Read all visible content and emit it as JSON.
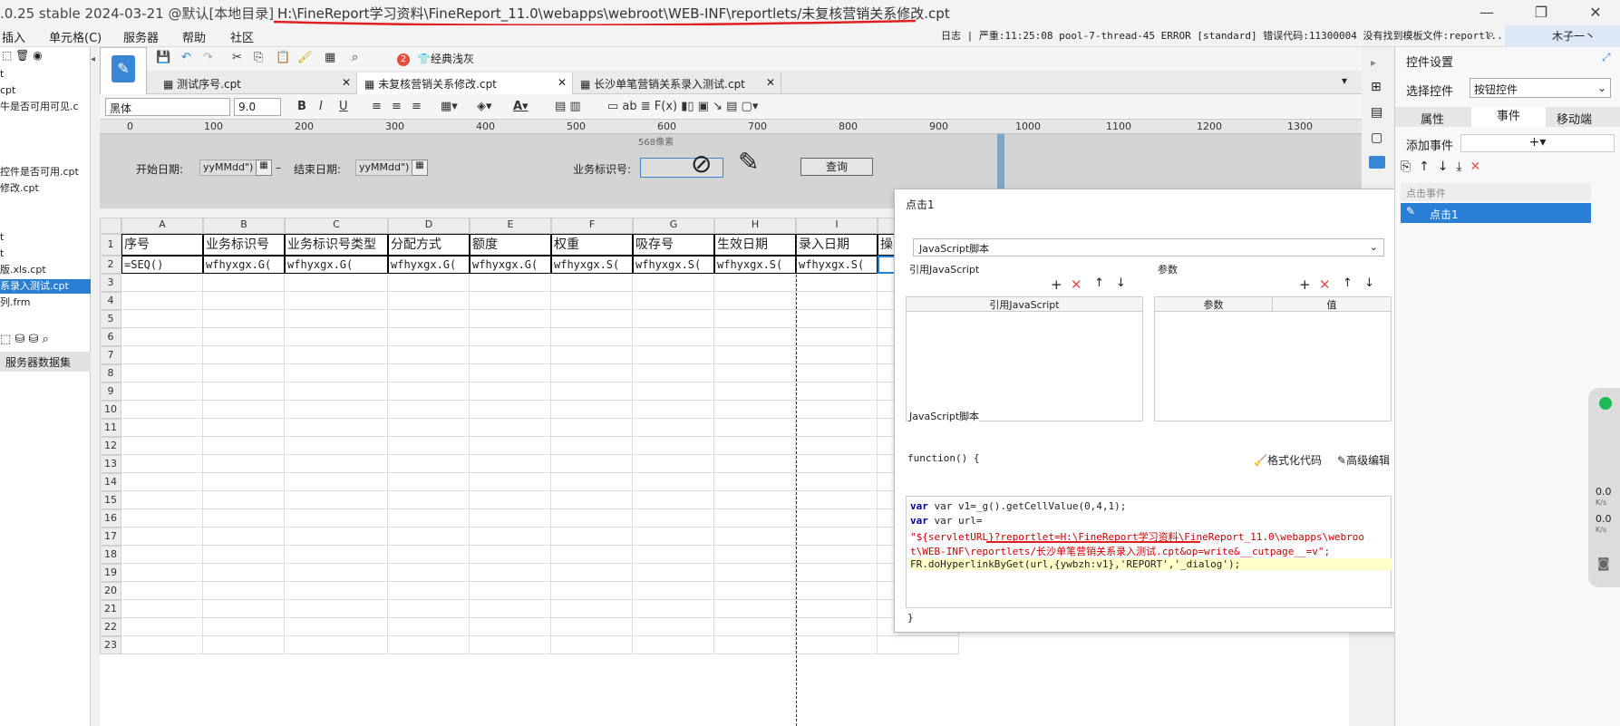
{
  "window": {
    "title": ".0.25 stable 2024-03-21 @默认[本地目录]",
    "path": "H:\\FineReport学习资料\\FineReport_11.0\\webapps\\webroot\\WEB-INF\\reportlets/未复核营销关系修改.cpt",
    "minimize": "—",
    "restore": "❐",
    "close": "✕"
  },
  "menu": [
    "插入",
    "单元格(C)",
    "服务器",
    "帮助",
    "社区"
  ],
  "log": {
    "label": "日志",
    "text": "| 严重:11:25:08 pool-7-thread-45 ERROR [standard] 错误代码:11300004 没有找到模板文件:reportl..."
  },
  "user": "木子一丶",
  "left_files": [
    "t",
    "cpt",
    "牛是否可用可见.c",
    "",
    "",
    "",
    "控件是否可用.cpt",
    "修改.cpt",
    "",
    "",
    "t",
    "t",
    "版.xls.cpt",
    "系录入测试.cpt",
    "列.frm"
  ],
  "server_dataset": "服务器数据集",
  "toolbar": {
    "badge": "2",
    "classic": "经典浅灰"
  },
  "tabs": [
    "测试序号.cpt",
    "未复核营销关系修改.cpt",
    "长沙单笔营销关系录入测试.cpt"
  ],
  "format": {
    "font": "黑体",
    "size": "9.0"
  },
  "ruler": [
    "0",
    "100",
    "200",
    "300",
    "400",
    "500",
    "600",
    "700",
    "800",
    "900",
    "1000",
    "1100",
    "1200",
    "1300"
  ],
  "ruler_note": "568像素",
  "params": {
    "start_label": "开始日期:",
    "start_value": "yyMMdd\")",
    "dash": "–",
    "end_label": "结束日期:",
    "end_value": "yyMMdd\")",
    "biz_label": "业务标识号:",
    "query": "查询"
  },
  "columns": [
    "A",
    "B",
    "C",
    "D",
    "E",
    "F",
    "G",
    "H",
    "I"
  ],
  "headers": [
    "序号",
    "业务标识号",
    "业务标识号类型",
    "分配方式",
    "额度",
    "权重",
    "吸存号",
    "生效日期",
    "录入日期",
    "操"
  ],
  "row2": [
    "=SEQ()",
    "wfhyxgx.G(",
    "wfhyxgx.G(",
    "wfhyxgx.G(",
    "wfhyxgx.G(",
    "wfhyxgx.S(",
    "wfhyxgx.S(",
    "wfhyxgx.S(",
    "wfhyxgx.S("
  ],
  "rows": [
    "1",
    "2",
    "3",
    "4",
    "5",
    "6",
    "7",
    "8",
    "9",
    "10",
    "11",
    "12",
    "13",
    "14",
    "15",
    "16",
    "17",
    "18",
    "19",
    "20",
    "21",
    "22",
    "23"
  ],
  "dialog": {
    "title": "点击1",
    "type": "JavaScript脚本",
    "ref_label": "引用JavaScript",
    "param_label": "参数",
    "col_ref": "引用JavaScript",
    "col_param": "参数",
    "col_value": "值",
    "script_label": "JavaScript脚本",
    "func_open": "function() {",
    "format_btn": "格式化代码",
    "adv_btn": "高级编辑",
    "func_close": "}",
    "code": [
      "var v1=_g().getCellValue(0,4,1);",
      "var url=",
      "\"${servletURL}?reportlet=H:\\FineReport学习资料\\FineReport_11.0\\webapps\\webroo",
      "t\\WEB-INF\\reportlets/长沙单笔营销关系录入测试.cpt&op=write&__cutpage__=v\";",
      "FR.doHyperlinkByGet(url,{ywbzh:v1},'REPORT','_dialog');"
    ]
  },
  "right": {
    "title": "控件设置",
    "select_label": "选择控件",
    "select_value": "按钮控件",
    "tabs": [
      "属性",
      "事件",
      "移动端"
    ],
    "add_event": "添加事件",
    "event_group": "点击事件",
    "event_item": "点击1"
  },
  "net": {
    "up": "0.0",
    "up_unit": "K/s",
    "down": "0.0",
    "down_unit": "K/s"
  },
  "colors": {
    "accent": "#2a7fd4",
    "error": "#d9534f"
  }
}
